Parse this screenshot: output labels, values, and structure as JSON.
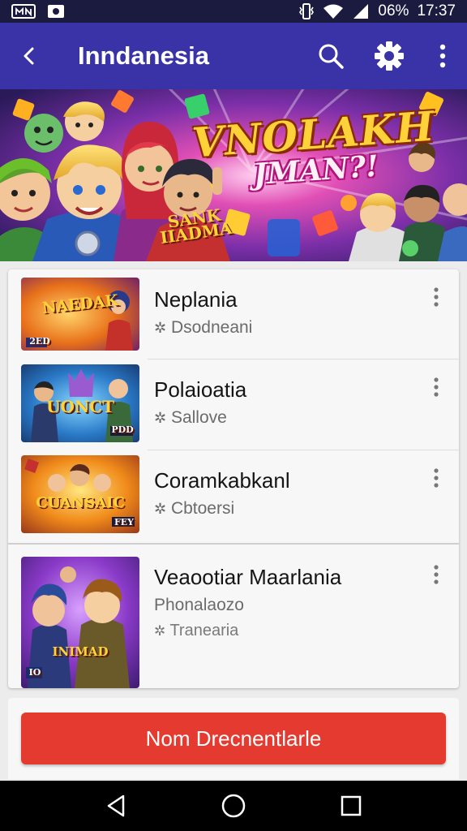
{
  "status_bar": {
    "battery": "06%",
    "time": "17:37",
    "icons": [
      "screenshot-icon",
      "notification-icon",
      "vibrate-icon",
      "wifi-icon",
      "signal-icon"
    ]
  },
  "app_bar": {
    "title": "Inndanesia",
    "icons": [
      "back-arrow-icon",
      "search-icon",
      "settings-gear-icon",
      "overflow-menu-icon"
    ]
  },
  "banner": {
    "title_line1": "VNOLAKH",
    "title_line2": "JMAN?!",
    "badge": "SANK\nIIADMA"
  },
  "list": {
    "items": [
      {
        "name": "Neplania",
        "sub": "Dsodneani",
        "thumb_text": "NAEDAK",
        "thumb_tag": "2ED"
      },
      {
        "name": "Polaioatia",
        "sub": "Sallove",
        "thumb_text": "UONCT",
        "thumb_tag": "PDD"
      },
      {
        "name": "Coramkabkanl",
        "sub": "Cbtoersi",
        "thumb_text": "CUANSAIC",
        "thumb_tag": "FEY"
      },
      {
        "name": "Veaootiar Maarlania",
        "sub": "Phonalaozo",
        "sub2": "Tranearia",
        "thumb_text": "INIMAD",
        "thumb_tag": "IO"
      }
    ]
  },
  "cta": {
    "label": "Nom Drecnentlarle"
  },
  "colors": {
    "app_bar": "#3a33a8",
    "status_bar": "#1b1b40",
    "cta": "#e53a2f",
    "background": "#ececec"
  }
}
